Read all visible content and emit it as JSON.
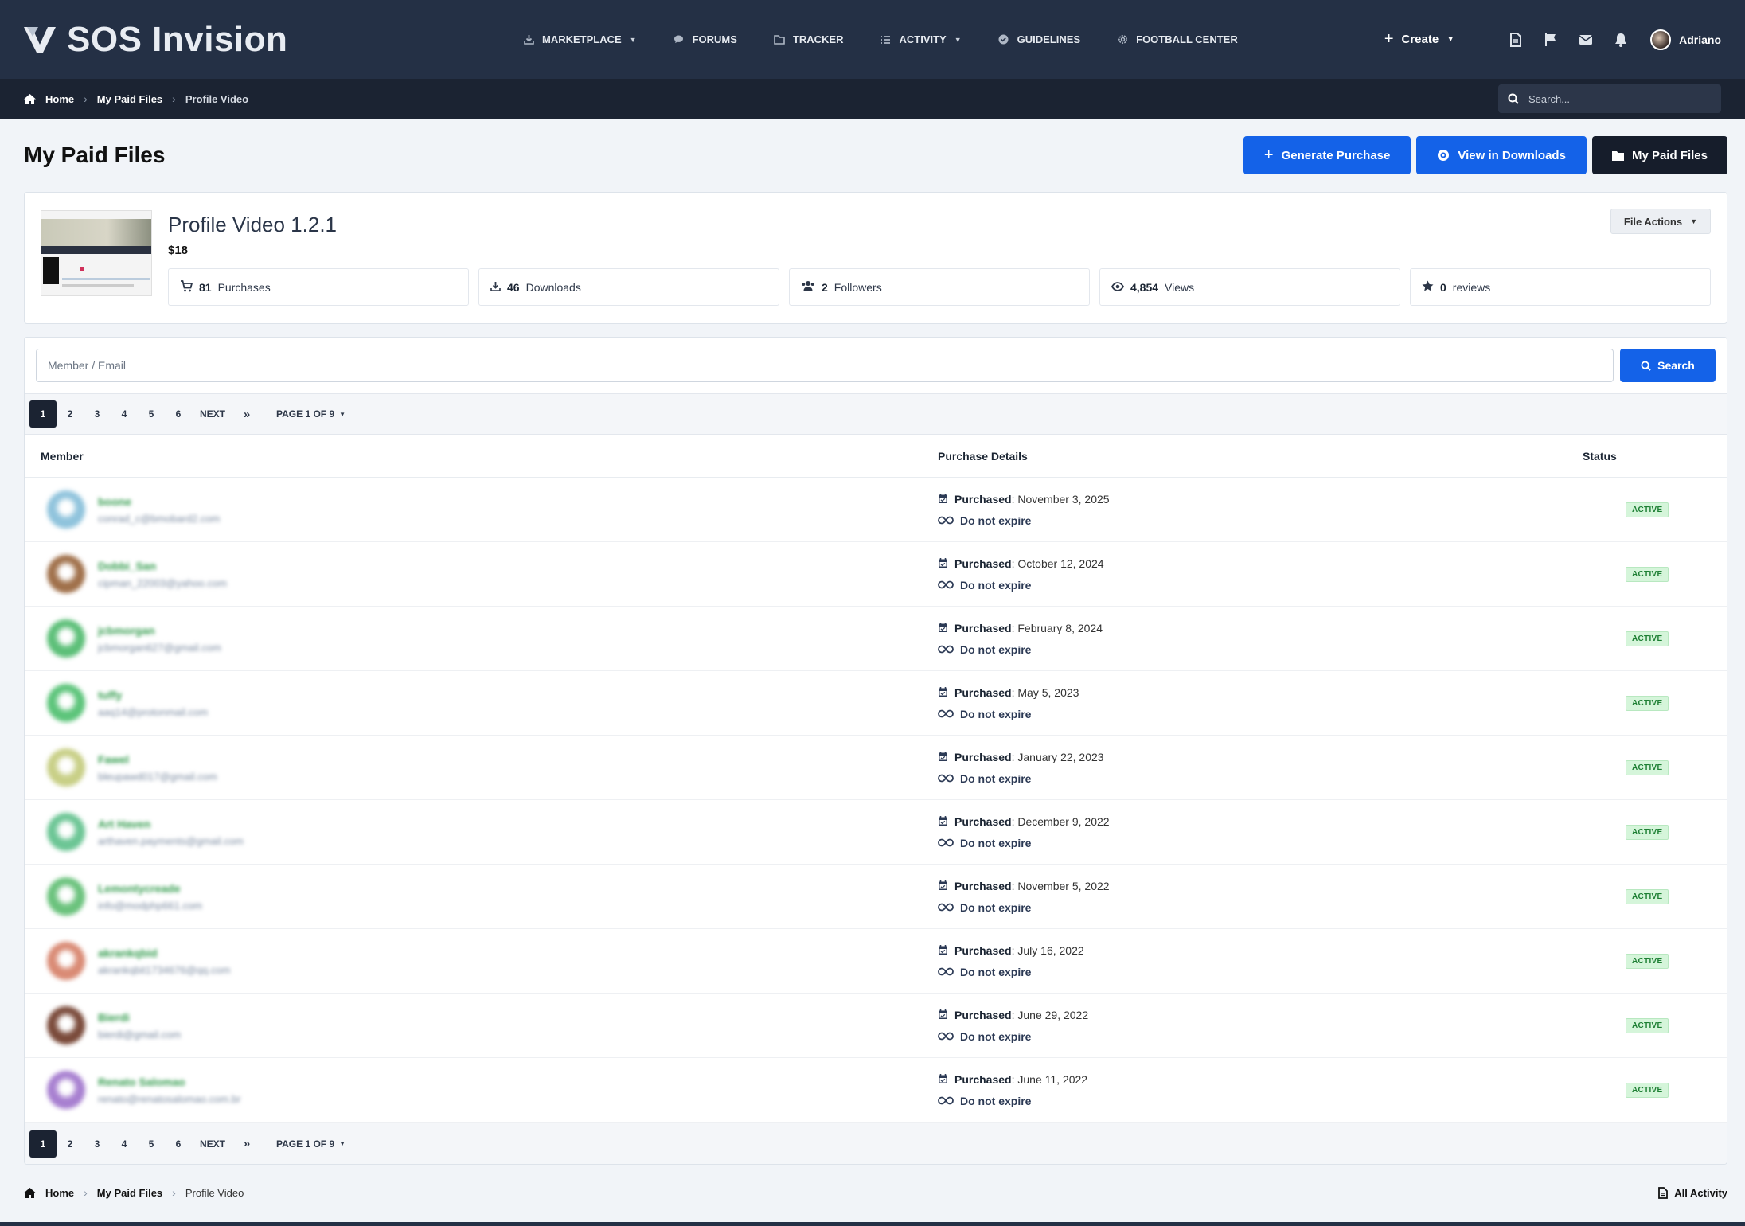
{
  "site": {
    "logo_text": "SOS Invision"
  },
  "nav": {
    "items": [
      {
        "label": "MARKETPLACE",
        "icon": "download-icon",
        "caret": true
      },
      {
        "label": "FORUMS",
        "icon": "chat-icon",
        "caret": false
      },
      {
        "label": "TRACKER",
        "icon": "folder-icon",
        "caret": false
      },
      {
        "label": "ACTIVITY",
        "icon": "list-icon",
        "caret": true
      },
      {
        "label": "GUIDELINES",
        "icon": "check-circle-icon",
        "caret": false
      },
      {
        "label": "FOOTBALL CENTER",
        "icon": "gear-icon",
        "caret": false
      }
    ],
    "create_label": "Create",
    "user_name": "Adriano"
  },
  "breadcrumb": {
    "home": "Home",
    "section": "My Paid Files",
    "current": "Profile Video"
  },
  "search": {
    "placeholder": "Search..."
  },
  "page": {
    "title": "My Paid Files",
    "buttons": {
      "generate": "Generate Purchase",
      "view": "View in Downloads",
      "mine": "My Paid Files"
    }
  },
  "file": {
    "title": "Profile Video 1.2.1",
    "price": "$18",
    "actions_label": "File Actions",
    "stats": [
      {
        "value": "81",
        "label": "Purchases",
        "icon": "cart-icon"
      },
      {
        "value": "46",
        "label": "Downloads",
        "icon": "download-icon"
      },
      {
        "value": "2",
        "label": "Followers",
        "icon": "users-icon"
      },
      {
        "value": "4,854",
        "label": "Views",
        "icon": "eye-icon"
      },
      {
        "value": "0",
        "label": "reviews",
        "icon": "star-icon"
      }
    ]
  },
  "filter": {
    "placeholder": "Member / Email",
    "button": "Search"
  },
  "pagination": {
    "pages": [
      "1",
      "2",
      "3",
      "4",
      "5",
      "6"
    ],
    "current": "1",
    "next": "NEXT",
    "last": "»",
    "jump": "PAGE 1 OF 9"
  },
  "table": {
    "headers": {
      "member": "Member",
      "details": "Purchase Details",
      "status": "Status"
    },
    "purchased_label": "Purchased",
    "expire_label": "Do not expire",
    "status_label": "ACTIVE",
    "rows": [
      {
        "name": "boone",
        "email": "conrad_c@bmobard2.com",
        "date": "November 3, 2025",
        "avatar": "#8fc3dc"
      },
      {
        "name": "Dobbi_San",
        "email": "cipman_22003@yahoo.com",
        "date": "October 12, 2024",
        "avatar": "#a0704a"
      },
      {
        "name": "jcbmorgan",
        "email": "jcbmorgan627@gmail.com",
        "date": "February 8, 2024",
        "avatar": "#5cbf78"
      },
      {
        "name": "tuffy",
        "email": "aaq14@protonmail.com",
        "date": "May 5, 2023",
        "avatar": "#5cc47a"
      },
      {
        "name": "Fawel",
        "email": "bleupawd017@gmail.com",
        "date": "January 22, 2023",
        "avatar": "#c8cf86"
      },
      {
        "name": "Art Haven",
        "email": "arthaven.payments@gmail.com",
        "date": "December 9, 2022",
        "avatar": "#6bc594"
      },
      {
        "name": "Lemontycreade",
        "email": "info@modphp661.com",
        "date": "November 5, 2022",
        "avatar": "#6ac27c"
      },
      {
        "name": "akrankqbid",
        "email": "akrankqbit1734676@qq.com",
        "date": "July 16, 2022",
        "avatar": "#d98a74"
      },
      {
        "name": "Bierdi",
        "email": "bierdi@gmail.com",
        "date": "June 29, 2022",
        "avatar": "#7a4a3a"
      },
      {
        "name": "Renato Salomao",
        "email": "renato@renatosalomao.com.br",
        "date": "June 11, 2022",
        "avatar": "#a77fd0"
      }
    ]
  },
  "footer": {
    "all_activity": "All Activity"
  },
  "colors": {
    "nav_bg": "#243045",
    "crumb_bg": "#1b2332",
    "primary": "#1462e8",
    "dark_button": "#161d2b",
    "active_badge": "#d5f5da"
  }
}
